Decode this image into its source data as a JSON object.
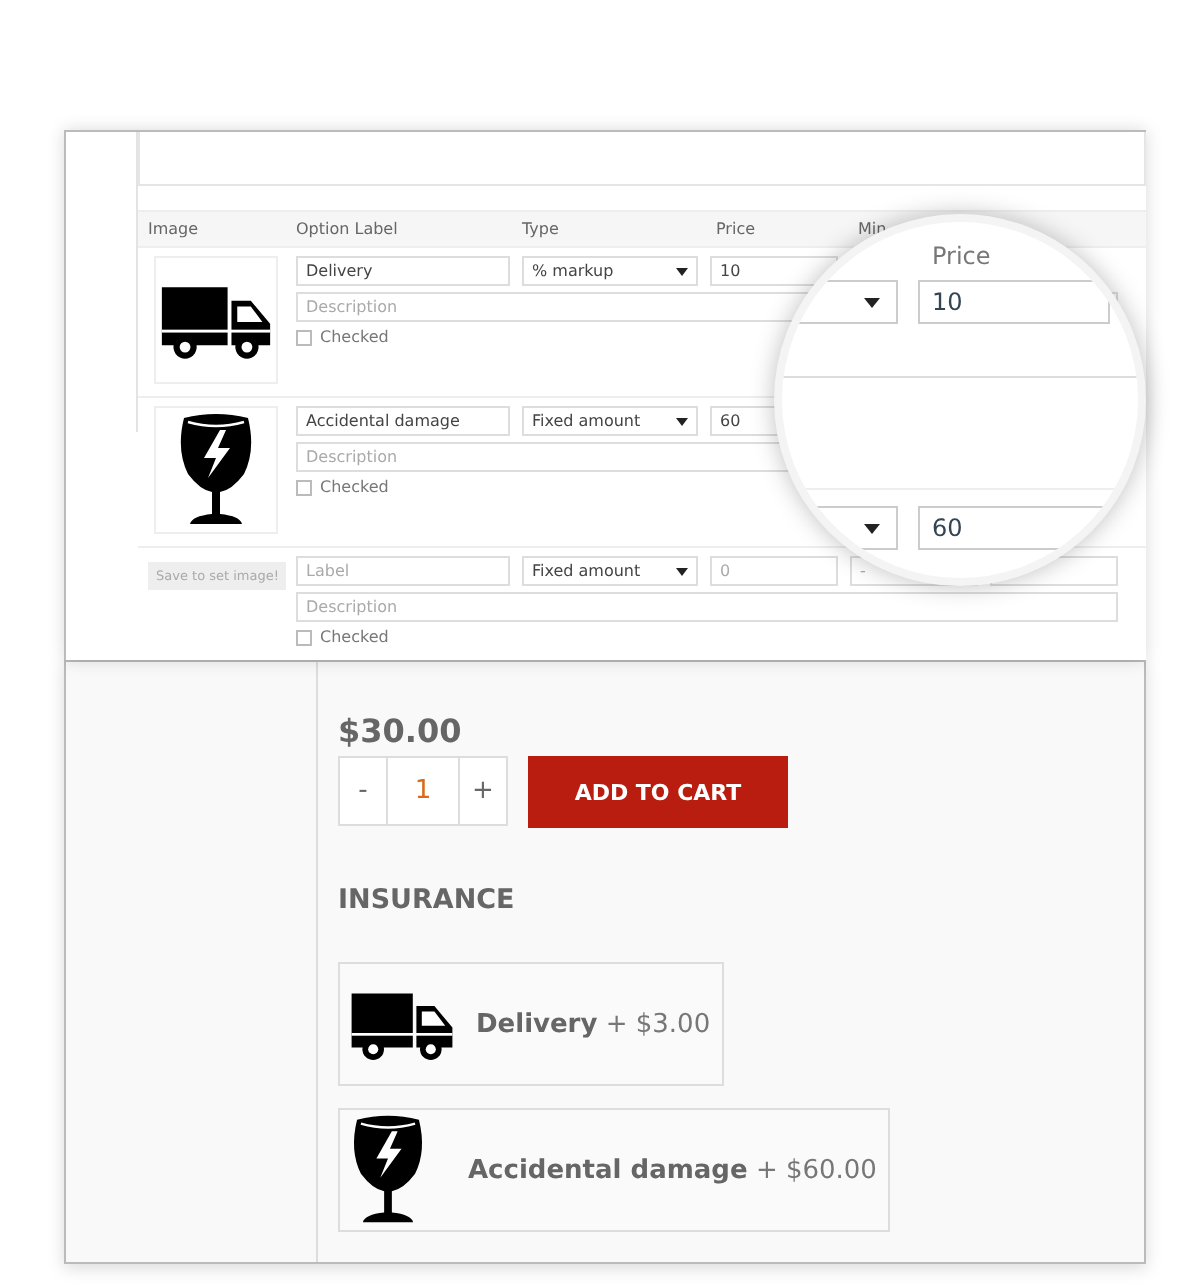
{
  "admin": {
    "columns": [
      "Image",
      "Option Label",
      "Type",
      "Price",
      "Min"
    ],
    "options": [
      {
        "label": "Delivery",
        "type": "% markup",
        "description_placeholder": "Description",
        "price": "10",
        "checked_label": "Checked",
        "checked": false
      },
      {
        "label": "Accidental damage",
        "type": "Fixed amount",
        "description_placeholder": "Description",
        "price": "60",
        "checked_label": "Checked",
        "checked": false
      },
      {
        "image_button": "Save to set image!",
        "label_placeholder": "Label",
        "type": "Fixed amount",
        "description_placeholder": "Description",
        "price_placeholder": "0",
        "min_placeholder": "-",
        "checked_label": "Checked",
        "checked": false
      }
    ]
  },
  "magnifier": {
    "column": "Price",
    "values": [
      "10",
      "60"
    ]
  },
  "product": {
    "price": "$30.00",
    "minus": "-",
    "quantity": "1",
    "plus": "+",
    "button": "ADD TO CART",
    "heading": "INSURANCE",
    "options": [
      {
        "name": "Delivery",
        "price": "+ $3.00"
      },
      {
        "name": "Accidental damage",
        "price": "+ $60.00"
      }
    ]
  }
}
